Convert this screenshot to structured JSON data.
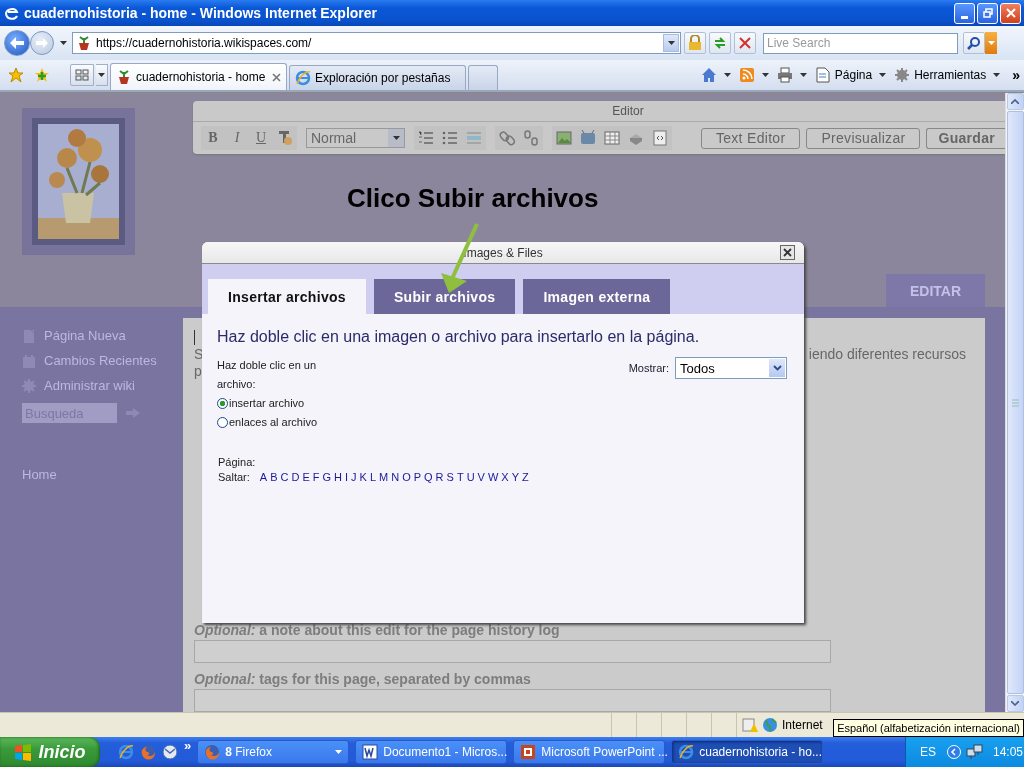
{
  "window": {
    "title": "cuadernohistoria - home - Windows Internet Explorer"
  },
  "address_bar": {
    "url": "https://cuadernohistoria.wikispaces.com/"
  },
  "search_box": {
    "placeholder": "Live Search"
  },
  "browser_tabs": [
    {
      "label": "cuadernohistoria - home",
      "selected": true
    },
    {
      "label": "Exploración por pestañas",
      "selected": false
    }
  ],
  "command_bar": {
    "items": [
      "Página",
      "Herramientas"
    ],
    "overflow": "»"
  },
  "editor": {
    "title": "Editor",
    "format_buttons": [
      "B",
      "I",
      "U"
    ],
    "format": "Normal",
    "buttons": [
      "Text Editor",
      "Previsualizar",
      "Guardar"
    ]
  },
  "annotation": "Clico Subir archivos",
  "page": {
    "edit_tab": "EDITAR",
    "sidebar": [
      "Página Nueva",
      "Cambios Recientes",
      "Administrar wiki"
    ],
    "search_placeholder": "Busqueda",
    "home_link": "Home",
    "text_lines": [
      "S",
      "p"
    ],
    "text_right": "iendo diferentes recursos",
    "note_label": "*Optional:* a note about this edit for the page history log",
    "tags_label": "*Optional:* tags for this page, separated by commas"
  },
  "dialog": {
    "title": "Images & Files",
    "tabs": [
      {
        "label": "Insertar archivos",
        "selected": true
      },
      {
        "label": "Subir archivos",
        "selected": false
      },
      {
        "label": "Imagen externa",
        "selected": false
      }
    ],
    "instruction": "Haz doble clic en una imagen o archivo para insertarlo en la página.",
    "action_label": "Haz doble clic en un archivo:",
    "actions": [
      {
        "label": "insertar archivo",
        "selected": true
      },
      {
        "label": "enlaces al archivo",
        "selected": false
      }
    ],
    "filter_label": "Mostrar:",
    "filter_value": "Todos",
    "page_label": "Página:",
    "jump_label": "Saltar:",
    "letters": [
      "A",
      "B",
      "C",
      "D",
      "E",
      "F",
      "G",
      "H",
      "I",
      "J",
      "K",
      "L",
      "M",
      "N",
      "O",
      "P",
      "Q",
      "R",
      "S",
      "T",
      "U",
      "V",
      "W",
      "X",
      "Y",
      "Z"
    ]
  },
  "status_bar": {
    "zone": "Internet",
    "tooltip": "Español (alfabetización internacional)"
  },
  "taskbar": {
    "start": "Inicio",
    "more": "»",
    "items": [
      {
        "kind": "firefox",
        "label": "**8** Firefox",
        "selected": false
      },
      {
        "kind": "word",
        "label": "Documento1 - Micros...",
        "selected": false
      },
      {
        "kind": "powerpoint",
        "label": "Microsoft PowerPoint ...",
        "selected": false
      },
      {
        "kind": "browser",
        "label": "cuadernohistoria - ho...",
        "selected": true
      }
    ],
    "language": "ES",
    "clock": "14:05"
  }
}
